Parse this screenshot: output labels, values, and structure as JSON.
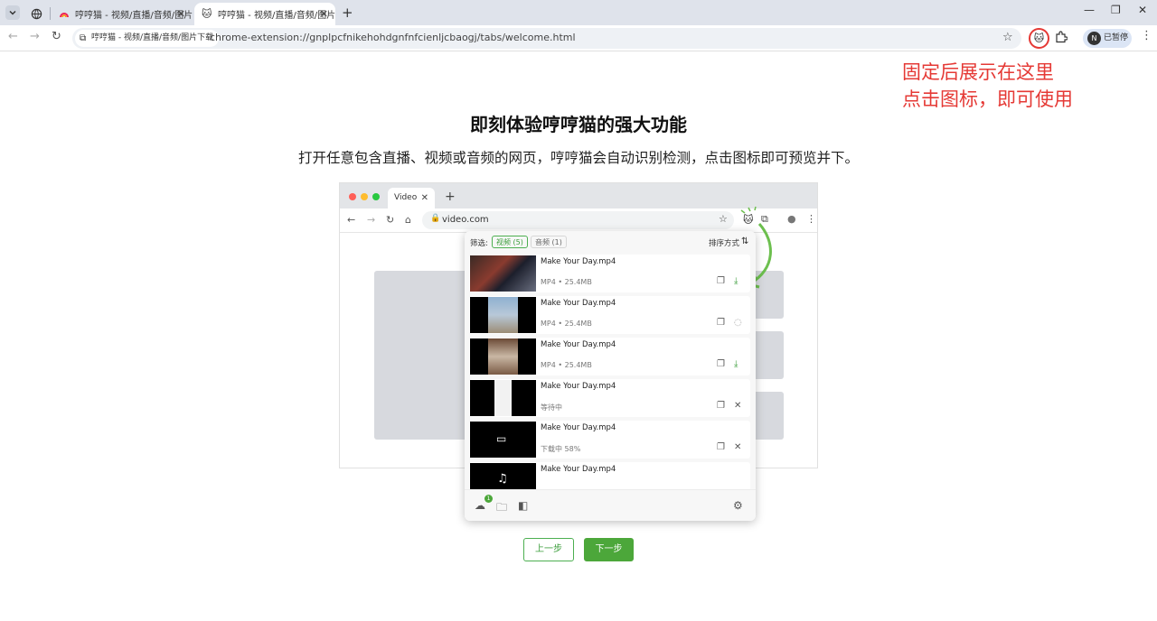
{
  "tabs": [
    {
      "title": "哼哼猫 - 视频/直播/音频/图片下",
      "active": false
    },
    {
      "title": "哼哼猫 - 视频/直播/音频/图片下",
      "active": true
    }
  ],
  "new_tab_icon": "plus-icon",
  "toolbar": {
    "site_chip": "哼哼猫 - 视频/直播/音频/图片下载",
    "url": "chrome-extension://gnplpcfnikehohdgnfnfcienljcbaogj/tabs/welcome.html",
    "profile_initial": "N",
    "profile_status": "已暂停"
  },
  "annotation": {
    "line1": "固定后展示在这里",
    "line2": "点击图标，即可使用",
    "color": "#e53935"
  },
  "main": {
    "title": "即刻体验哼哼猫的强大功能",
    "subtitle": "打开任意包含直播、视频或音频的网页，哼哼猫会自动识别检测，点击图标即可预览并下。"
  },
  "mock_browser": {
    "tab_title": "Video",
    "url": "video.com"
  },
  "popup": {
    "filter_label": "筛选:",
    "filter_video": "视频 (5)",
    "filter_audio": "音频 (1)",
    "sort_label": "排序方式",
    "items": [
      {
        "name": "Make Your Day.mp4",
        "meta": "MP4 • 25.4MB",
        "status": "download"
      },
      {
        "name": "Make Your Day.mp4",
        "meta": "MP4 • 25.4MB",
        "status": "loading"
      },
      {
        "name": "Make Your Day.mp4",
        "meta": "MP4 • 25.4MB",
        "status": "download"
      },
      {
        "name": "Make Your Day.mp4",
        "meta": "等待中",
        "status": "waiting"
      },
      {
        "name": "Make Your Day.mp4",
        "meta": "下载中  58%",
        "status": "downloading"
      },
      {
        "name": "Make Your Day.mp4",
        "meta": "",
        "status": "partial"
      }
    ],
    "badge_count": "1"
  },
  "buttons": {
    "prev": "上一步",
    "next": "下一步"
  },
  "colors": {
    "accent_green": "#4ca73a",
    "tabstrip_bg": "#dfe3eb"
  }
}
